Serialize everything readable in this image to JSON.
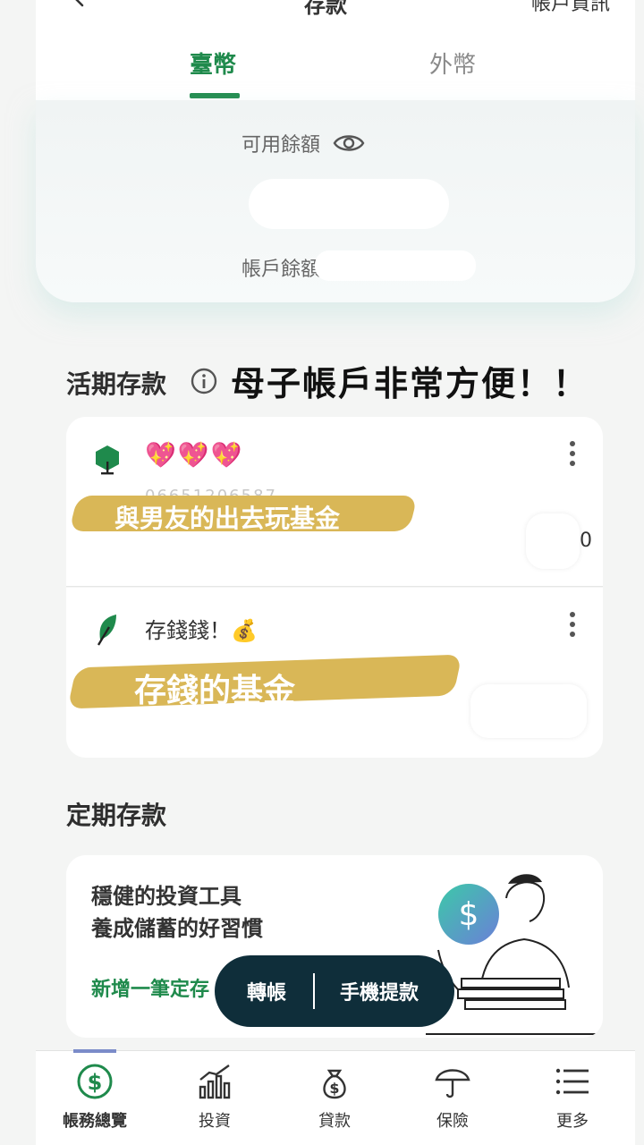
{
  "header": {
    "title": "存款",
    "account_info": "帳戶資訊"
  },
  "tabs": [
    {
      "label": "臺幣",
      "active": true
    },
    {
      "label": "外幣",
      "active": false
    }
  ],
  "balance": {
    "available_label": "可用餘額",
    "account_balance_label": "帳戶餘額"
  },
  "demand_deposit": {
    "title": "活期存款",
    "overlay_caption": "母子帳戶非常方便！！",
    "accounts": [
      {
        "name": "💖💖💖",
        "number": "06651206587",
        "caption": "與男友的出去玩基金",
        "balance_tail": "0"
      },
      {
        "name": "存錢錢！💰",
        "caption": "存錢的基金"
      }
    ]
  },
  "fixed_deposit": {
    "title": "定期存款",
    "promo_line1": "穩健的投資工具",
    "promo_line2": "養成儲蓄的好習慣",
    "add_link": "新增一筆定存"
  },
  "fab": {
    "transfer": "轉帳",
    "withdraw": "手機提款"
  },
  "bottom_nav": [
    {
      "label": "帳務總覽",
      "icon": "dollar-circle-icon",
      "active": true
    },
    {
      "label": "投資",
      "icon": "chart-icon",
      "active": false
    },
    {
      "label": "貸款",
      "icon": "money-bag-icon",
      "active": false
    },
    {
      "label": "保險",
      "icon": "umbrella-icon",
      "active": false
    },
    {
      "label": "更多",
      "icon": "menu-icon",
      "active": false
    }
  ],
  "colors": {
    "accent_green": "#1f8a4c",
    "fab_background": "#0f2e3a",
    "highlight_tape": "#d9b757"
  }
}
